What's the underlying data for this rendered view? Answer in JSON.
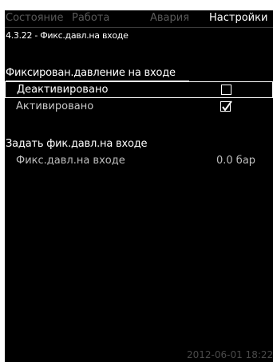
{
  "tabs": [
    {
      "label": "Состояние",
      "active": false
    },
    {
      "label": "Работа",
      "active": false
    },
    {
      "label": "Авария",
      "active": false
    },
    {
      "label": "Настройки",
      "active": true
    }
  ],
  "breadcrumb": "4.3.22 - Фикс.давл.на входе",
  "section_mode": {
    "title": "Фиксирован.давление на входе",
    "options": [
      {
        "label": "Деактивировано",
        "checked": false,
        "selected": true
      },
      {
        "label": "Активировано",
        "checked": true,
        "selected": false
      }
    ]
  },
  "section_value": {
    "title": "Задать фик.давл.на входе",
    "param_label": "Фикс.давл.на входе",
    "param_value": "0.0 бар"
  },
  "status_time": "2012-06-01 18:22",
  "colors": {
    "background": "#000000",
    "text": "#ffffff",
    "dim_text": "#5a5a5a"
  }
}
